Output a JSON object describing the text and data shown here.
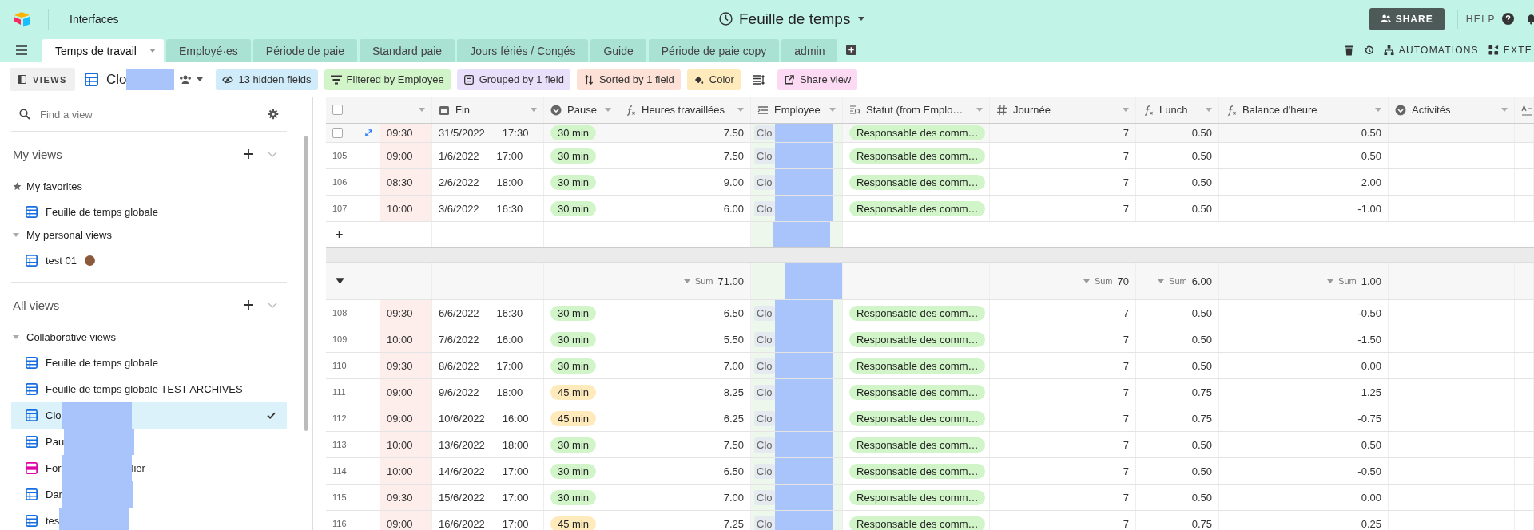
{
  "topbar": {
    "app_label": "Interfaces",
    "title": "Feuille de temps",
    "share": "SHARE",
    "help": "HELP"
  },
  "tabs": [
    {
      "label": "Temps de travail",
      "selected": true
    },
    {
      "label": "Employé·es",
      "selected": false
    },
    {
      "label": "Période de paie",
      "selected": false
    },
    {
      "label": "Standard paie",
      "selected": false
    },
    {
      "label": "Jours fériés / Congés",
      "selected": false
    },
    {
      "label": "Guide",
      "selected": false
    },
    {
      "label": "Période de paie copy",
      "selected": false
    },
    {
      "label": "admin",
      "selected": false
    }
  ],
  "tab_actions": {
    "automations": "AUTOMATIONS",
    "extensions": "EXTE"
  },
  "toolbar": {
    "views": "VIEWS",
    "view_name": "Clo",
    "buttons": [
      {
        "kind": "hidden",
        "label": "13 hidden fields",
        "color": "#d0ebf9"
      },
      {
        "kind": "filter",
        "label": "Filtered by Employee",
        "color": "#d1f5c9"
      },
      {
        "kind": "group",
        "label": "Grouped by 1 field",
        "color": "#e8dffb"
      },
      {
        "kind": "sort",
        "label": "Sorted by 1 field",
        "color": "#fde0d6"
      },
      {
        "kind": "color",
        "label": "Color",
        "color": "#feeabb"
      },
      {
        "kind": "rowheight"
      },
      {
        "kind": "share",
        "label": "Share view",
        "color": "#fcdaf3"
      }
    ]
  },
  "sidebar": {
    "search_placeholder": "Find a view",
    "sections": [
      {
        "title": "My views",
        "groups": [
          {
            "title": "My favorites",
            "kind": "favorites",
            "items": [
              {
                "label": "Feuille de temps globale",
                "kind": "grid",
                "selected": false
              }
            ]
          },
          {
            "title": "My personal views",
            "kind": "folder",
            "expanded": true,
            "items": [
              {
                "label": "test 01",
                "kind": "grid",
                "selected": false,
                "avatar": true
              }
            ]
          }
        ]
      },
      {
        "title": "All views",
        "groups": [
          {
            "title": "Collaborative views",
            "kind": "folder",
            "expanded": true,
            "items": [
              {
                "label": "Feuille de temps globale",
                "kind": "grid",
                "selected": false
              },
              {
                "label": "Feuille de temps globale TEST ARCHIVES",
                "kind": "grid",
                "selected": false
              },
              {
                "label": "Clo",
                "kind": "grid",
                "selected": true,
                "redacted": true
              },
              {
                "label": "Pau",
                "kind": "grid",
                "selected": false,
                "redacted": true
              },
              {
                "label": "For",
                "label_end": "lier",
                "kind": "form",
                "selected": false,
                "redacted": true
              },
              {
                "label": "Dar",
                "kind": "grid",
                "selected": false,
                "redacted": true
              },
              {
                "label": "tes",
                "kind": "grid",
                "selected": false,
                "redacted": true
              }
            ]
          }
        ]
      }
    ]
  },
  "table": {
    "select_all_checked": false,
    "columns": [
      {
        "kind": "checkbox"
      },
      {
        "kind": "untitled"
      },
      {
        "kind": "date",
        "label": "Fin"
      },
      {
        "kind": "select",
        "label": "Pause"
      },
      {
        "kind": "formula",
        "label": "Heures travaillées"
      },
      {
        "kind": "link",
        "label": "Employee"
      },
      {
        "kind": "lookup",
        "label": "Statut (from Emplo…"
      },
      {
        "kind": "number",
        "label": "Journée"
      },
      {
        "kind": "formula",
        "label": "Lunch"
      },
      {
        "kind": "formula",
        "label": "Balance d'heure"
      },
      {
        "kind": "select",
        "label": "Activités"
      },
      {
        "kind": "text"
      }
    ],
    "groups": [
      {
        "add_row": "+",
        "rows": [
          {
            "hovered": true,
            "start": "09:30",
            "date": "31/5/2022",
            "end": "17:30",
            "pause": {
              "label": "30 min",
              "color": "#d1f5c9"
            },
            "hours": "7.50",
            "employee": "Clo",
            "statut": "Responsable des comm…",
            "journee": "7",
            "lunch": "0.50",
            "balance": "0.50"
          },
          {
            "hovered": false,
            "number": "105",
            "start": "09:00",
            "date": "1/6/2022",
            "end": "17:00",
            "pause": {
              "label": "30 min",
              "color": "#d1f5c9"
            },
            "hours": "7.50",
            "employee": "Clo",
            "statut": "Responsable des comm…",
            "journee": "7",
            "lunch": "0.50",
            "balance": "0.50"
          },
          {
            "hovered": false,
            "number": "106",
            "start": "08:30",
            "date": "2/6/2022",
            "end": "18:00",
            "pause": {
              "label": "30 min",
              "color": "#d1f5c9"
            },
            "hours": "9.00",
            "employee": "Clo",
            "statut": "Responsable des comm…",
            "journee": "7",
            "lunch": "0.50",
            "balance": "2.00"
          },
          {
            "hovered": false,
            "number": "107",
            "start": "10:00",
            "date": "3/6/2022",
            "end": "16:30",
            "pause": {
              "label": "30 min",
              "color": "#d1f5c9"
            },
            "hours": "6.00",
            "employee": "Clo",
            "statut": "Responsable des comm…",
            "journee": "7",
            "lunch": "0.50",
            "balance": "-1.00"
          }
        ]
      },
      {
        "expanded": true,
        "summary": {
          "hours": {
            "label": "Sum",
            "value": "71.00"
          },
          "journee": {
            "label": "Sum",
            "value": "70"
          },
          "lunch": {
            "label": "Sum",
            "value": "6.00"
          },
          "balance": {
            "label": "Sum",
            "value": "1.00"
          }
        },
        "rows": [
          {
            "hovered": false,
            "number": "108",
            "start": "09:30",
            "date": "6/6/2022",
            "end": "16:30",
            "pause": {
              "label": "30 min",
              "color": "#d1f5c9"
            },
            "hours": "6.50",
            "employee": "Clo",
            "statut": "Responsable des comm…",
            "journee": "7",
            "lunch": "0.50",
            "balance": "-0.50"
          },
          {
            "hovered": false,
            "number": "109",
            "start": "10:00",
            "date": "7/6/2022",
            "end": "16:00",
            "pause": {
              "label": "30 min",
              "color": "#d1f5c9"
            },
            "hours": "5.50",
            "employee": "Clo",
            "statut": "Responsable des comm…",
            "journee": "7",
            "lunch": "0.50",
            "balance": "-1.50"
          },
          {
            "hovered": false,
            "number": "110",
            "start": "09:30",
            "date": "8/6/2022",
            "end": "17:00",
            "pause": {
              "label": "30 min",
              "color": "#d1f5c9"
            },
            "hours": "7.00",
            "employee": "Clo",
            "statut": "Responsable des comm…",
            "journee": "7",
            "lunch": "0.50",
            "balance": "0.00"
          },
          {
            "hovered": false,
            "number": "111",
            "start": "09:00",
            "date": "9/6/2022",
            "end": "18:00",
            "pause": {
              "label": "45 min",
              "color": "#feeabb"
            },
            "hours": "8.25",
            "employee": "Clo",
            "statut": "Responsable des comm…",
            "journee": "7",
            "lunch": "0.75",
            "balance": "1.25"
          },
          {
            "hovered": false,
            "number": "112",
            "start": "09:00",
            "date": "10/6/2022",
            "end": "16:00",
            "pause": {
              "label": "45 min",
              "color": "#feeabb"
            },
            "hours": "6.25",
            "employee": "Clo",
            "statut": "Responsable des comm…",
            "journee": "7",
            "lunch": "0.75",
            "balance": "-0.75"
          },
          {
            "hovered": false,
            "number": "113",
            "start": "10:00",
            "date": "13/6/2022",
            "end": "18:00",
            "pause": {
              "label": "30 min",
              "color": "#d1f5c9"
            },
            "hours": "7.50",
            "employee": "Clo",
            "statut": "Responsable des comm…",
            "journee": "7",
            "lunch": "0.50",
            "balance": "0.50"
          },
          {
            "hovered": false,
            "number": "114",
            "start": "10:00",
            "date": "14/6/2022",
            "end": "17:00",
            "pause": {
              "label": "30 min",
              "color": "#d1f5c9"
            },
            "hours": "6.50",
            "employee": "Clo",
            "statut": "Responsable des comm…",
            "journee": "7",
            "lunch": "0.50",
            "balance": "-0.50"
          },
          {
            "hovered": false,
            "number": "115",
            "start": "09:30",
            "date": "15/6/2022",
            "end": "17:00",
            "pause": {
              "label": "30 min",
              "color": "#d1f5c9"
            },
            "hours": "7.00",
            "employee": "Clo",
            "statut": "Responsable des comm…",
            "journee": "7",
            "lunch": "0.50",
            "balance": "0.00"
          },
          {
            "hovered": false,
            "number": "116",
            "start": "09:00",
            "date": "16/6/2022",
            "end": "17:00",
            "pause": {
              "label": "45 min",
              "color": "#feeabb"
            },
            "hours": "7.25",
            "employee": "Clo",
            "statut": "Responsable des comm…",
            "journee": "7",
            "lunch": "0.75",
            "balance": "0.25"
          }
        ]
      }
    ]
  }
}
